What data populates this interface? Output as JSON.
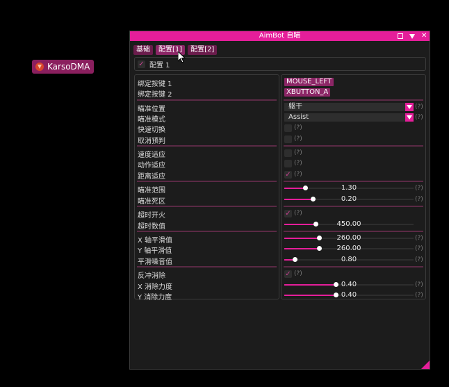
{
  "overlay": {
    "label": "KarsoDMA"
  },
  "window": {
    "title": "AimBot 自瞄",
    "icons": [
      "restore-icon",
      "collapse-icon",
      "close-icon"
    ]
  },
  "tabs": [
    {
      "label": "基础",
      "active": false
    },
    {
      "label": "配置[1]",
      "active": true
    },
    {
      "label": "配置[2]",
      "active": false
    }
  ],
  "config": {
    "label": "配置 1",
    "checked": true
  },
  "settings": {
    "bind1": {
      "label": "绑定按键 1",
      "value": "MOUSE_LEFT"
    },
    "bind2": {
      "label": "绑定按键 2",
      "value": "XBUTTON_A"
    },
    "aim_pos": {
      "label": "瞄准位置",
      "value": "躯干"
    },
    "aim_mode": {
      "label": "瞄准模式",
      "value": "Assist"
    },
    "quick_switch": {
      "label": "快速切换",
      "checked": false
    },
    "cancel_predict": {
      "label": "取消预判",
      "checked": false
    },
    "speed_adapt": {
      "label": "速度适应",
      "checked": false
    },
    "action_adapt": {
      "label": "动作适应",
      "checked": false
    },
    "distance_adapt": {
      "label": "距离适应",
      "checked": true
    },
    "aim_range": {
      "label": "瞄准范围",
      "value": "1.30",
      "fraction": 0.16
    },
    "aim_deadzone": {
      "label": "瞄准死区",
      "value": "0.20",
      "fraction": 0.22
    },
    "timeout_fire": {
      "label": "超时开火",
      "checked": true
    },
    "timeout_value": {
      "label": "超时数值",
      "value": "450.00",
      "fraction": 0.24
    },
    "x_smooth": {
      "label": "X 轴平滑值",
      "value": "260.00",
      "fraction": 0.27
    },
    "y_smooth": {
      "label": "Y 轴平滑值",
      "value": "260.00",
      "fraction": 0.27
    },
    "smooth_noise": {
      "label": "平滑噪音值",
      "value": "0.80",
      "fraction": 0.08
    },
    "recoil": {
      "label": "反冲消除",
      "checked": true
    },
    "x_recoil": {
      "label": "X 消除力度",
      "value": "0.40",
      "fraction": 0.4
    },
    "y_recoil": {
      "label": "Y 消除力度",
      "value": "0.40",
      "fraction": 0.4
    }
  },
  "help_marker": "(?)",
  "colors": {
    "accent": "#e51e9a",
    "button": "#8c2666",
    "background": "#1c1c1c"
  }
}
